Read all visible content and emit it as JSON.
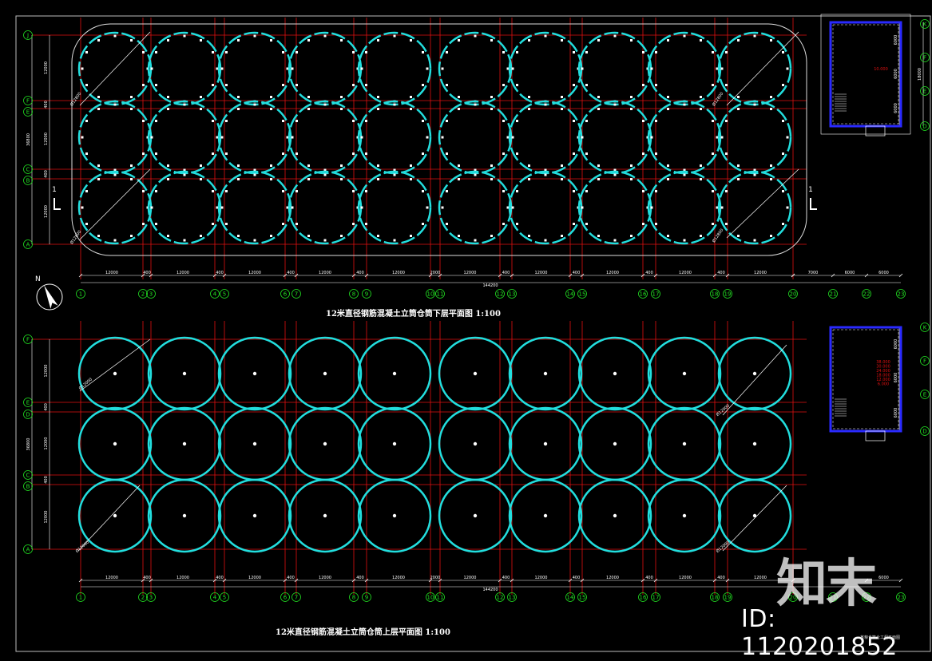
{
  "drawing": {
    "title_top": "12米直径钢筋混凝土立筒仓筒下层平面图 1:100",
    "title_bottom": "12米直径钢筋混凝土立筒仓筒上层平面图 1:100",
    "section_mark": "1",
    "north_label": "N"
  },
  "grid_axes_bottom": [
    "1",
    "2",
    "3",
    "4",
    "5",
    "6",
    "7",
    "8",
    "9",
    "10",
    "11",
    "12",
    "13",
    "14",
    "15",
    "16",
    "17",
    "18",
    "19",
    "20",
    "21",
    "22",
    "23"
  ],
  "grid_axes_left_top": [
    "J",
    "F",
    "E",
    "C",
    "B",
    "A"
  ],
  "grid_axes_left_bottom": [
    "F",
    "E",
    "D",
    "C",
    "B",
    "A"
  ],
  "grid_axes_right_top": [
    "K",
    "F",
    "E",
    "D"
  ],
  "grid_axes_right_bottom": [
    "K",
    "F",
    "E",
    "D"
  ],
  "dimensions": {
    "bay": "12000",
    "gap": "400",
    "mid": "2000",
    "total": "144200",
    "left_top": [
      "12000",
      "400",
      "12000",
      "400",
      "12000"
    ],
    "left_total": "36800",
    "right_top": [
      "6000",
      "6000",
      "6000"
    ],
    "right_top_total": "18000",
    "right_bottom": [
      "6000",
      "6000",
      "6000"
    ],
    "extra_top": [
      "7000",
      "6000",
      "6000"
    ],
    "extra_bottom": [
      "6000"
    ]
  },
  "silo_labels": {
    "diameter_a": "Ø12000",
    "diameter_b": "Ø12800"
  },
  "stair_tower": {
    "level_top": "10.000",
    "levels_bottom": [
      "38.000",
      "30.000",
      "24.000",
      "18.000",
      "12.000",
      "6.000"
    ]
  },
  "watermark": {
    "logo": "知末",
    "id": "ID: 1120201852",
    "small_note": "某粮食筒仓工程平面图"
  },
  "colors": {
    "silo": "#22dede",
    "grid": "#e01010",
    "dim": "#ffffff",
    "axis_bubble": "#22e022",
    "wall": "#2a2aff",
    "bg": "#000000"
  }
}
